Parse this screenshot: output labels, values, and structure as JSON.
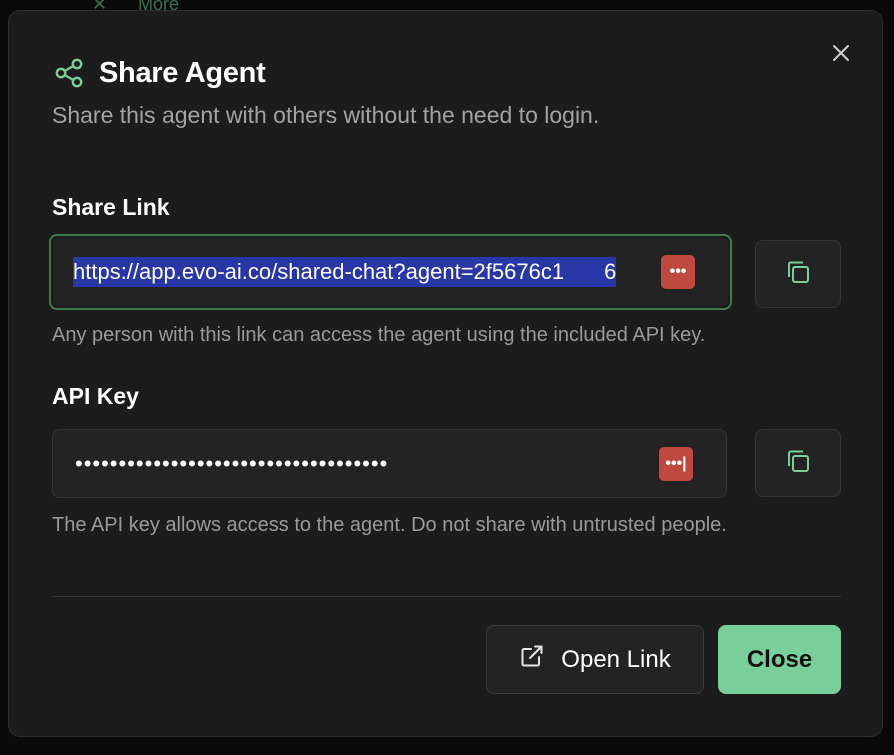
{
  "background": {
    "behind_label": "More",
    "behind_icon": "x-icon"
  },
  "dialog": {
    "title": "Share Agent",
    "subtitle": "Share this agent with others without the need to login.",
    "title_icon": "share-icon",
    "close_icon": "close-icon"
  },
  "share_link": {
    "label": "Share Link",
    "value": "https://app.evo-ai.co/shared-chat?agent=2f5676c1",
    "value_tail": "6",
    "helper": "Any person with this link can access the agent using the included API key.",
    "copy_icon": "copy-icon",
    "mask_label": "•••"
  },
  "api_key": {
    "label": "API Key",
    "value": "••••••••••••••••••••••••••••••••••••",
    "helper": "The API key allows access to the agent. Do not share with untrusted people.",
    "copy_icon": "copy-icon",
    "mask_label": "•••|"
  },
  "footer": {
    "open_link_label": "Open Link",
    "open_link_icon": "external-link-icon",
    "close_label": "Close"
  },
  "colors": {
    "accent": "#79cf9a",
    "selection": "#2836a8",
    "mask_badge": "#c0493f",
    "focus_ring": "#3f7a4f"
  }
}
